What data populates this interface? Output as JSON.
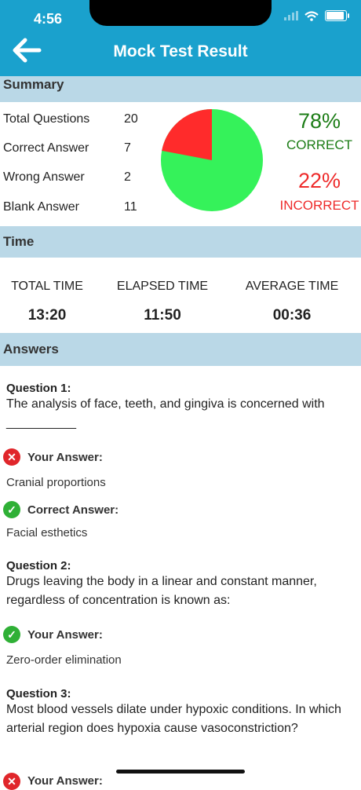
{
  "status": {
    "time": "4:56"
  },
  "header": {
    "title": "Mock Test Result"
  },
  "summary": {
    "heading": "Summary",
    "rows": [
      {
        "label": "Total Questions",
        "value": "20"
      },
      {
        "label": "Correct Answer",
        "value": "7"
      },
      {
        "label": "Wrong Answer",
        "value": "2"
      },
      {
        "label": "Blank Answer",
        "value": "11"
      }
    ],
    "correct_pct": "78%",
    "correct_label": "CORRECT",
    "incorrect_pct": "22%",
    "incorrect_label": "INCORRECT",
    "pie": {
      "correct_fraction": 0.78,
      "correct_color": "#35f25a",
      "incorrect_color": "#ff2b2b"
    }
  },
  "time": {
    "heading": "Time",
    "total_label": "TOTAL TIME",
    "total_value": "13:20",
    "elapsed_label": "ELAPSED TIME",
    "elapsed_value": "11:50",
    "average_label": "AVERAGE TIME",
    "average_value": "00:36"
  },
  "answers": {
    "heading": "Answers",
    "your_answer_label": "Your Answer:",
    "correct_answer_label": "Correct Answer:",
    "q1": {
      "number": "Question 1:",
      "text": "The analysis of face, teeth, and gingiva is concerned with __________",
      "your": "Cranial proportions",
      "correct": "Facial esthetics"
    },
    "q2": {
      "number": "Question 2:",
      "text": "Drugs leaving the body in a linear and constant manner, regardless of concentration is known as:",
      "your": "Zero-order elimination"
    },
    "q3": {
      "number": "Question 3:",
      "text": "Most blood vessels dilate under hypoxic conditions. In which arterial region does hypoxia cause vasoconstriction?"
    }
  }
}
